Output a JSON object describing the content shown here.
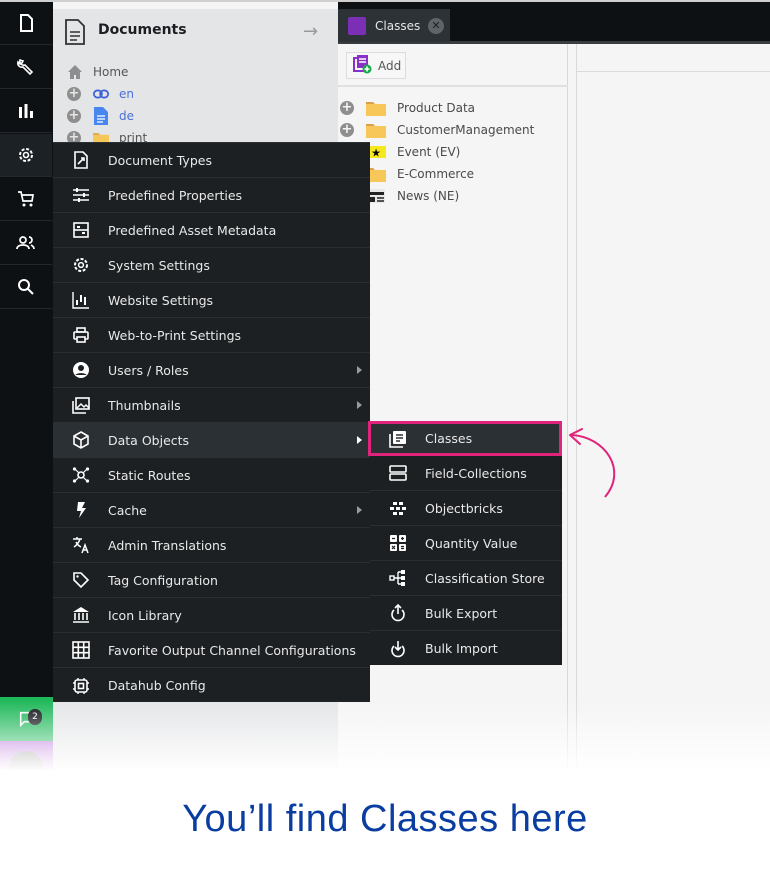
{
  "rail": {
    "items": [
      {
        "icon": "document-icon"
      },
      {
        "icon": "wrench-icon"
      },
      {
        "icon": "chart-icon"
      },
      {
        "icon": "gear-icon"
      },
      {
        "icon": "cart-icon"
      },
      {
        "icon": "users-icon"
      },
      {
        "icon": "search-icon"
      }
    ],
    "notifications_count": "2"
  },
  "documents": {
    "title": "Documents",
    "tree": [
      {
        "label": "Home",
        "icon": "home-icon"
      },
      {
        "label": "en",
        "icon": "link-icon"
      },
      {
        "label": "de",
        "icon": "page-icon"
      },
      {
        "label": "print",
        "icon": "folder-icon"
      }
    ]
  },
  "tabs": [
    {
      "label": "Classes",
      "icon": "classes-icon",
      "closable": true
    }
  ],
  "classes_panel": {
    "add_label": "Add",
    "tree": [
      {
        "label": "Product Data",
        "icon": "folder-icon",
        "expandable": true
      },
      {
        "label": "CustomerManagement",
        "icon": "folder-icon",
        "expandable": true
      },
      {
        "label": "Event (EV)",
        "icon": "star-ticket-icon",
        "expandable": false
      },
      {
        "label": "E-Commerce",
        "icon": "folder-icon",
        "expandable": false
      },
      {
        "label": "News (NE)",
        "icon": "newspaper-icon",
        "expandable": false
      }
    ]
  },
  "settings_menu": {
    "items": [
      {
        "label": "Document Types",
        "icon": "document-types-icon",
        "submenu": false
      },
      {
        "label": "Predefined Properties",
        "icon": "sliders-icon",
        "submenu": false
      },
      {
        "label": "Predefined Asset Metadata",
        "icon": "metadata-icon",
        "submenu": false
      },
      {
        "label": "System Settings",
        "icon": "gear-icon",
        "submenu": false
      },
      {
        "label": "Website Settings",
        "icon": "website-settings-icon",
        "submenu": false
      },
      {
        "label": "Web-to-Print Settings",
        "icon": "printer-icon",
        "submenu": false
      },
      {
        "label": "Users / Roles",
        "icon": "user-icon",
        "submenu": true
      },
      {
        "label": "Thumbnails",
        "icon": "images-icon",
        "submenu": true
      },
      {
        "label": "Data Objects",
        "icon": "cube-icon",
        "submenu": true,
        "highlighted": true
      },
      {
        "label": "Static Routes",
        "icon": "network-icon",
        "submenu": false
      },
      {
        "label": "Cache",
        "icon": "lightning-icon",
        "submenu": true
      },
      {
        "label": "Admin Translations",
        "icon": "translate-icon",
        "submenu": false
      },
      {
        "label": "Tag Configuration",
        "icon": "tag-icon",
        "submenu": false
      },
      {
        "label": "Icon Library",
        "icon": "library-icon",
        "submenu": false
      },
      {
        "label": "Favorite Output Channel Configurations",
        "icon": "grid-icon",
        "submenu": false
      },
      {
        "label": "Datahub Config",
        "icon": "chip-icon",
        "submenu": false
      }
    ]
  },
  "data_objects_submenu": {
    "items": [
      {
        "label": "Classes",
        "icon": "classes-icon",
        "highlighted": true
      },
      {
        "label": "Field-Collections",
        "icon": "field-collections-icon"
      },
      {
        "label": "Objectbricks",
        "icon": "bricks-icon"
      },
      {
        "label": "Quantity Value",
        "icon": "calculator-icon"
      },
      {
        "label": "Classification Store",
        "icon": "hierarchy-icon"
      },
      {
        "label": "Bulk Export",
        "icon": "export-icon"
      },
      {
        "label": "Bulk Import",
        "icon": "import-icon"
      }
    ]
  },
  "colors": {
    "highlight": "#e0237b",
    "caption": "#0a3da1",
    "menu_bg": "#1c2023",
    "rail_bg": "#0d1114"
  },
  "caption": "You’ll find Classes here"
}
